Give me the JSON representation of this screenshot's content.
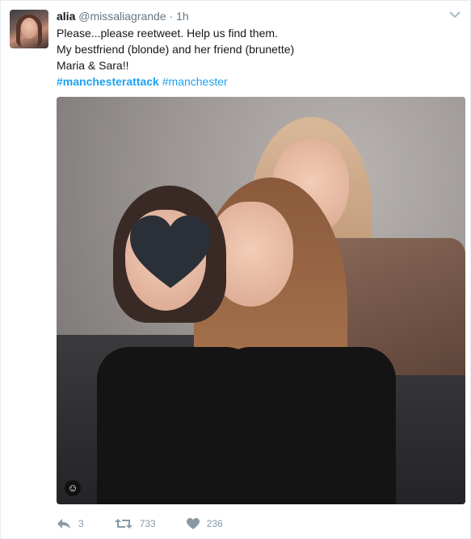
{
  "tweet": {
    "fullname": "alia",
    "username": "@missaliagrande",
    "separator": "·",
    "time": "1h",
    "lines": [
      "Please...please reetweet. Help us find them.",
      "My bestfriend (blonde) and her friend (brunette)",
      "Maria & Sara!!"
    ],
    "hashtags": [
      "#manchesterattack",
      "#manchester"
    ]
  },
  "actions": {
    "reply_count": "3",
    "retweet_count": "733",
    "like_count": "236"
  },
  "colors": {
    "link": "#1da1f2",
    "muted": "#657786",
    "action": "#8899a6"
  },
  "icons": [
    "caret-down-icon",
    "reply-icon",
    "retweet-icon",
    "heart-icon",
    "smiley-icon"
  ]
}
